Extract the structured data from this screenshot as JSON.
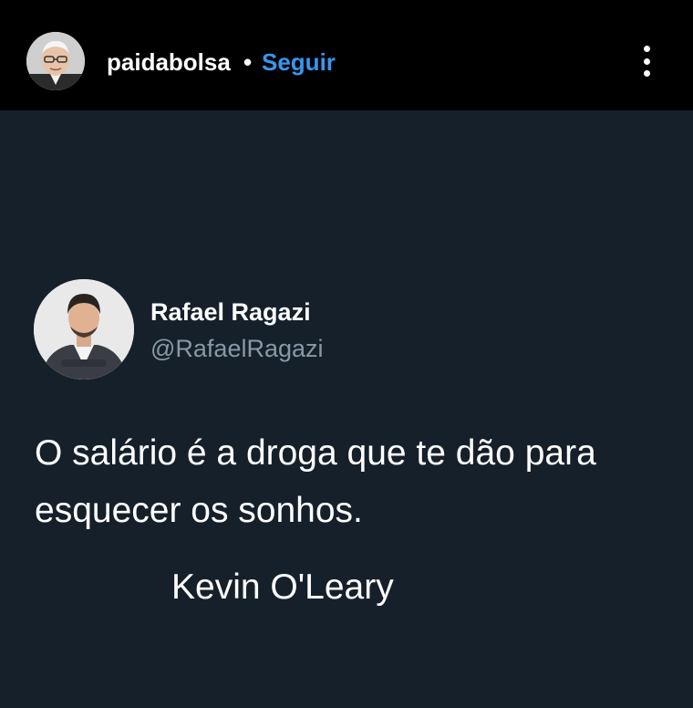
{
  "header": {
    "username": "paidabolsa",
    "separator": "•",
    "follow_label": "Seguir",
    "avatar_icon": "profile-photo",
    "more_icon": "more-vertical-icon"
  },
  "tweet": {
    "display_name": "Rafael Ragazi",
    "handle": "@RafaelRagazi",
    "avatar_icon": "profile-photo",
    "text": "O salário é a droga que te dão para esquecer os sonhos.",
    "attribution": "Kevin O'Leary"
  },
  "colors": {
    "header_bg": "#000000",
    "body_bg": "#15202b",
    "follow_blue": "#3797f0",
    "handle_gray": "#8899a6"
  }
}
